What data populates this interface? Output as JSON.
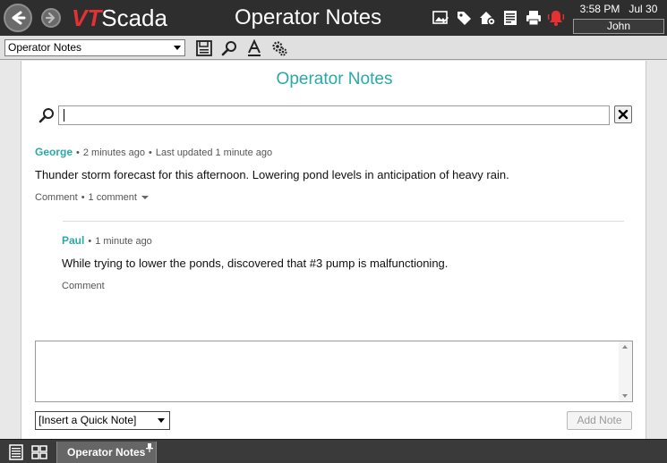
{
  "titlebar": {
    "logo_vt": "VT",
    "logo_scada": "Scada",
    "title": "Operator Notes",
    "time": "3:58 PM",
    "date": "Jul 30",
    "user": "John"
  },
  "toolbar": {
    "page_select_value": "Operator Notes"
  },
  "main": {
    "title": "Operator Notes",
    "search": {
      "value": ""
    },
    "notes": [
      {
        "author": "George",
        "time": "2 minutes ago",
        "updated": "Last updated 1 minute ago",
        "body": "Thunder storm forecast for this afternoon. Lowering pond levels in anticipation of heavy rain.",
        "comment_label": "Comment",
        "comment_count": "1 comment"
      },
      {
        "author": "Paul",
        "time": "1 minute ago",
        "body": "While trying to lower the ponds, discovered that #3 pump is malfunctioning.",
        "comment_label": "Comment"
      }
    ],
    "quick_note_value": "[Insert a Quick Note]",
    "add_note_label": "Add Note"
  },
  "bottombar": {
    "tab_label": "Operator Notes"
  },
  "colors": {
    "accent": "#2ba8a8",
    "brand_red": "#e53131",
    "alarm_red": "#e53131",
    "titlebar_bg": "#2e2e2e"
  },
  "icons": [
    "back-arrow-icon",
    "forward-arrow-icon",
    "image-edit-icon",
    "tag-icon",
    "home-gear-icon",
    "report-icon",
    "printer-icon",
    "alarm-bell-icon",
    "save-icon",
    "search-icon",
    "font-icon",
    "settings-gears-icon",
    "clear-icon",
    "page-list-icon",
    "grid-icon",
    "pin-icon"
  ]
}
